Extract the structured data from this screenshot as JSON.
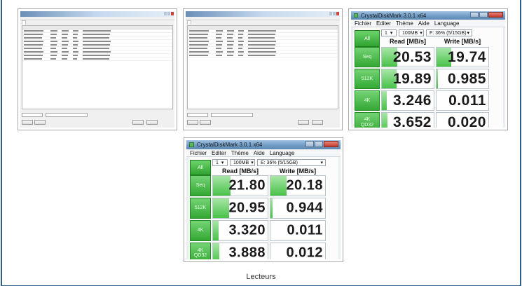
{
  "gallery": {
    "caption": "Lecteurs"
  },
  "cdm_small": {
    "title": "CrystalDiskMark 3.0.1 x64",
    "menu": [
      "Fichier",
      "Editer",
      "Thème",
      "Aide",
      "Language"
    ],
    "all_label": "All",
    "count": "1",
    "size": "100MB",
    "drive": "F: 36% (5/15GB)",
    "read_header": "Read [MB/s]",
    "write_header": "Write [MB/s]",
    "rows": [
      {
        "label": "Seq",
        "read": "20.53",
        "write": "19.74",
        "read_fill": 0.3,
        "write_fill": 0.28
      },
      {
        "label": "512K",
        "read": "19.89",
        "write": "0.985",
        "read_fill": 0.29,
        "write_fill": 0.03
      },
      {
        "label": "4K",
        "read": "3.246",
        "write": "0.011",
        "read_fill": 0.1,
        "write_fill": 0.0
      },
      {
        "label": "4K\nQD32",
        "read": "3.652",
        "write": "0.020",
        "read_fill": 0.11,
        "write_fill": 0.0
      }
    ]
  },
  "cdm_large": {
    "title": "CrystalDiskMark 3.0.1 x64",
    "menu": [
      "Fichier",
      "Editer",
      "Thème",
      "Aide",
      "Language"
    ],
    "all_label": "All",
    "count": "1",
    "size": "100MB",
    "drive": "E: 36% (5/15GB)",
    "read_header": "Read [MB/s]",
    "write_header": "Write [MB/s]",
    "rows": [
      {
        "label": "Seq",
        "read": "21.80",
        "write": "20.18",
        "read_fill": 0.32,
        "write_fill": 0.29
      },
      {
        "label": "512K",
        "read": "20.95",
        "write": "0.944",
        "read_fill": 0.3,
        "write_fill": 0.04
      },
      {
        "label": "4K",
        "read": "3.320",
        "write": "0.011",
        "read_fill": 0.1,
        "write_fill": 0.0
      },
      {
        "label": "4K\nQD32",
        "read": "3.888",
        "write": "0.012",
        "read_fill": 0.11,
        "write_fill": 0.0
      }
    ]
  }
}
